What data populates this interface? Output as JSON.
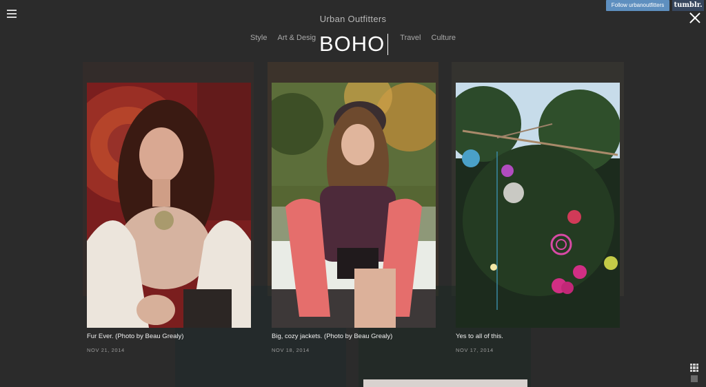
{
  "site": {
    "title": "Urban Outfitters"
  },
  "nav": {
    "items": [
      "Style",
      "Art & Desig",
      "Travel",
      "Culture"
    ]
  },
  "search": {
    "query": "BOHO"
  },
  "header": {
    "follow_label": "Follow urbanoutfitters",
    "tumblr_label": "tumblr."
  },
  "posts": [
    {
      "caption": "Fur Ever. (Photo by Beau Grealy)",
      "date": "NOV 21, 2014"
    },
    {
      "caption": "Big, cozy jackets. (Photo by Beau Grealy)",
      "date": "NOV 18, 2014"
    },
    {
      "caption": "Yes to all of this.",
      "date": "NOV 17, 2014"
    }
  ],
  "icons": {
    "menu": "hamburger-icon",
    "close": "close-icon",
    "grid": "grid-view-icon",
    "single": "single-view-icon"
  },
  "colors": {
    "overlay": "#2b2b2b",
    "follow": "#5e8fbf",
    "tumblr": "#36465d"
  }
}
